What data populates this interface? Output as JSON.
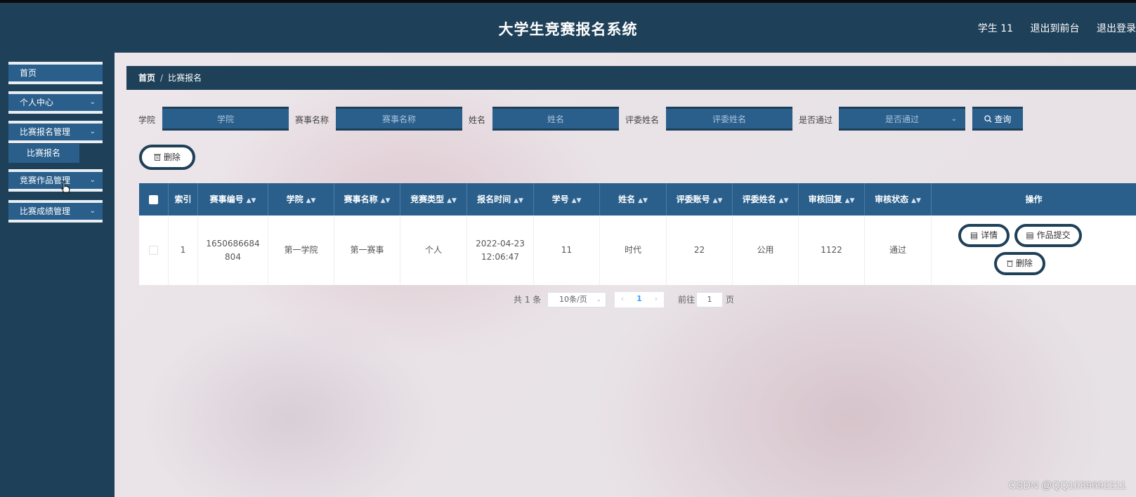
{
  "header": {
    "title": "大学生竞赛报名系统",
    "user": "学生 11",
    "back_to_front": "退出到前台",
    "logout": "退出登录"
  },
  "sidebar": {
    "items": [
      {
        "label": "首页"
      },
      {
        "label": "个人中心"
      },
      {
        "label": "比赛报名管理"
      },
      {
        "label": "竞赛作品管理"
      },
      {
        "label": "比赛成绩管理"
      }
    ],
    "sub_item": "比赛报名"
  },
  "breadcrumb": {
    "home": "首页",
    "separator": "/",
    "current": "比赛报名"
  },
  "filters": {
    "college_label": "学院",
    "college_placeholder": "学院",
    "contest_label": "赛事名称",
    "contest_placeholder": "赛事名称",
    "name_label": "姓名",
    "name_placeholder": "姓名",
    "judge_label": "评委姓名",
    "judge_placeholder": "评委姓名",
    "passed_label": "是否通过",
    "passed_placeholder": "是否通过",
    "search_label": "查询"
  },
  "toolbar": {
    "delete_label": "删除"
  },
  "table": {
    "columns": [
      "索引",
      "赛事编号",
      "学院",
      "赛事名称",
      "竞赛类型",
      "报名时间",
      "学号",
      "姓名",
      "评委账号",
      "评委姓名",
      "审核回复",
      "审核状态",
      "操作"
    ],
    "rows": [
      {
        "index": "1",
        "contest_no": "1650686684804",
        "college": "第一学院",
        "contest_name": "第一赛事",
        "contest_type": "个人",
        "signup_time": "2022-04-23 12:06:47",
        "student_no": "11",
        "name": "时代",
        "judge_account": "22",
        "judge_name": "公用",
        "review_reply": "1122",
        "review_status": "通过",
        "actions": {
          "detail": "详情",
          "submit_work": "作品提交",
          "delete": "删除"
        }
      }
    ]
  },
  "pagination": {
    "total": "共 1 条",
    "page_size": "10条/页",
    "current_page": "1",
    "goto_label": "前往",
    "goto_value": "1",
    "page_suffix": "页"
  },
  "watermark": "CSDN @QQ1039692211",
  "colors": {
    "primary": "#2a5f8c",
    "dark": "#1e4058"
  }
}
